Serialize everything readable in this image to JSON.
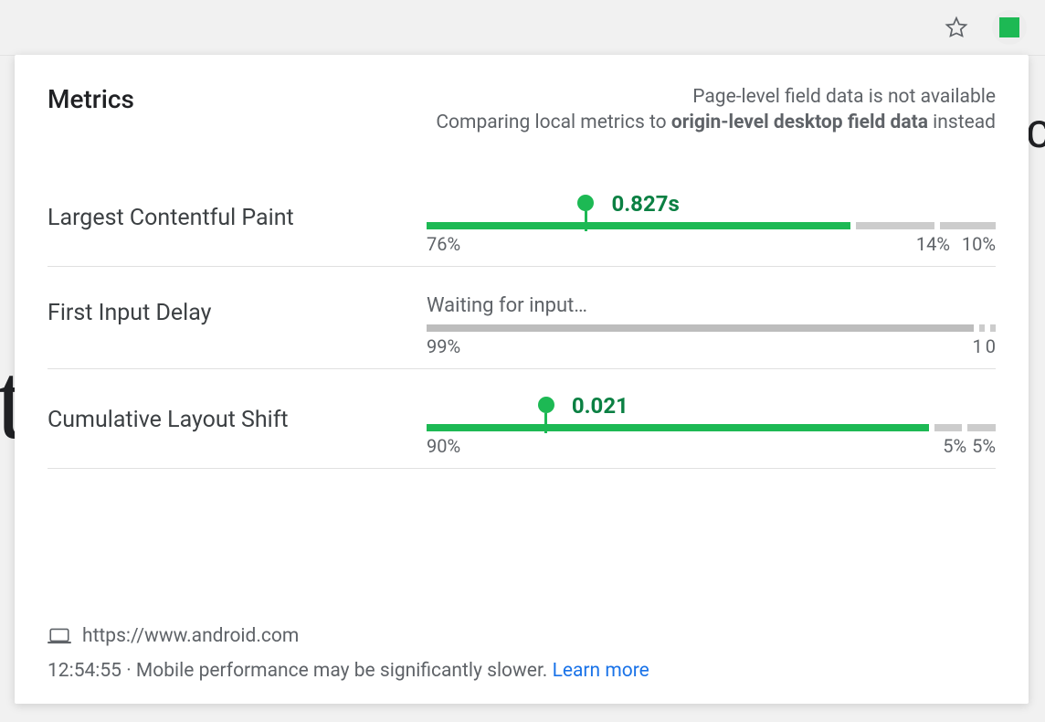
{
  "topbar": {
    "star_icon": "star-icon",
    "extension_icon": "web-vitals-extension",
    "extension_badge_color": "#1db954"
  },
  "popup": {
    "title": "Metrics",
    "note_line1": "Page-level field data is not available",
    "note_line2_prefix": "Comparing local metrics to ",
    "note_line2_strong": "origin-level desktop field data",
    "note_line2_suffix": " instead"
  },
  "metrics": [
    {
      "name": "Largest Contentful Paint",
      "value": "0.827s",
      "status": "good",
      "marker_percent": 28,
      "segments": {
        "good": 76,
        "needs_improvement": 14,
        "poor": 10
      },
      "seg_labels": {
        "good": "76%",
        "needs_improvement": "14%",
        "poor": "10%"
      },
      "waiting": false
    },
    {
      "name": "First Input Delay",
      "value": "",
      "status": "waiting",
      "waiting_label": "Waiting for input…",
      "segments": {
        "good": 99,
        "needs_improvement": 1,
        "poor": 0
      },
      "seg_labels": {
        "good": "99%",
        "ni_short": "1",
        "poor_short": "0"
      },
      "waiting": true
    },
    {
      "name": "Cumulative Layout Shift",
      "value": "0.021",
      "status": "good",
      "marker_percent": 24,
      "segments": {
        "good": 90,
        "needs_improvement": 5,
        "poor": 5
      },
      "seg_labels": {
        "good": "90%",
        "needs_improvement": "5%",
        "poor": "5%"
      },
      "waiting": false
    }
  ],
  "footer": {
    "device_icon": "laptop-icon",
    "url": "https://www.android.com",
    "time": "12:54:55",
    "separator": " · ",
    "warning": "Mobile performance may be significantly slower. ",
    "learn_more": "Learn more"
  },
  "colors": {
    "good": "#1db954",
    "text_secondary": "#5f6368",
    "link": "#1a73e8"
  }
}
